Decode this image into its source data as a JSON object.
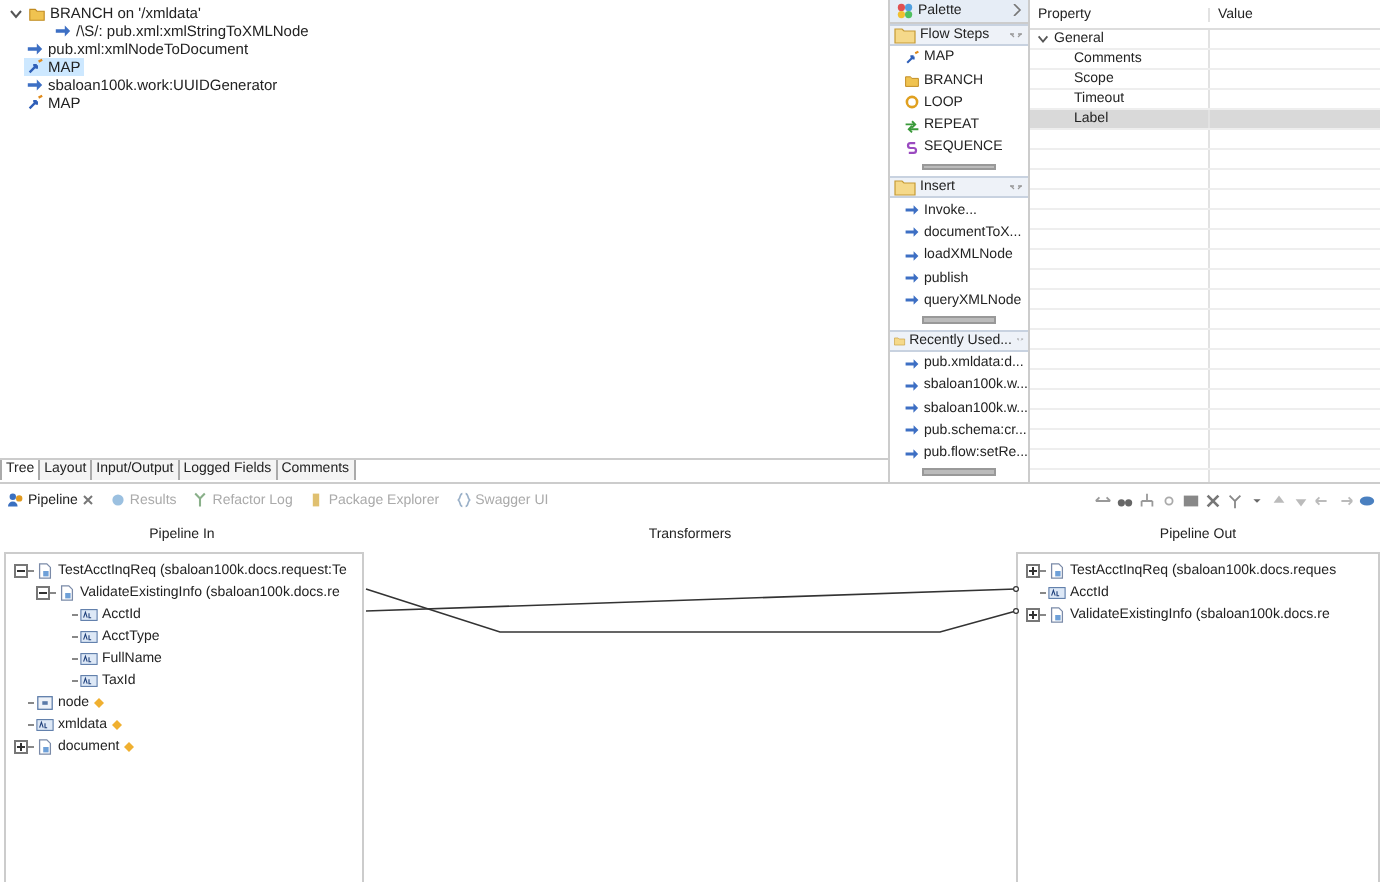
{
  "flow_tree": {
    "items": [
      {
        "kind": "branch",
        "label": "BRANCH on '/xmldata'",
        "expanded": true,
        "selected": false,
        "children": [
          {
            "kind": "invoke",
            "label": "/\\S/: pub.xml:xmlStringToXMLNode",
            "selected": false
          }
        ]
      },
      {
        "kind": "invoke",
        "label": "pub.xml:xmlNodeToDocument",
        "selected": false
      },
      {
        "kind": "map",
        "label": "MAP",
        "selected": true
      },
      {
        "kind": "invoke",
        "label": "sbaloan100k.work:UUIDGenerator",
        "selected": false
      },
      {
        "kind": "map",
        "label": "MAP",
        "selected": false
      }
    ]
  },
  "editor_tabs": [
    {
      "label": "Tree",
      "selected": true
    },
    {
      "label": "Layout",
      "selected": false
    },
    {
      "label": "Input/Output",
      "selected": false
    },
    {
      "label": "Logged Fields",
      "selected": false
    },
    {
      "label": "Comments",
      "selected": false
    }
  ],
  "palette": {
    "title": "Palette",
    "sections": [
      {
        "title": "Flow Steps",
        "items": [
          {
            "kind": "map",
            "label": "MAP"
          },
          {
            "kind": "branch",
            "label": "BRANCH"
          },
          {
            "kind": "loop",
            "label": "LOOP"
          },
          {
            "kind": "repeat",
            "label": "REPEAT"
          },
          {
            "kind": "sequence",
            "label": "SEQUENCE"
          }
        ]
      },
      {
        "title": "Insert",
        "items": [
          {
            "kind": "invoke",
            "label": "Invoke..."
          },
          {
            "kind": "invoke",
            "label": "documentToX..."
          },
          {
            "kind": "invoke",
            "label": "loadXMLNode"
          },
          {
            "kind": "invoke",
            "label": "publish"
          },
          {
            "kind": "invoke",
            "label": "queryXMLNode"
          }
        ]
      },
      {
        "title": "Recently Used...",
        "items": [
          {
            "kind": "invoke",
            "label": "pub.xmldata:d..."
          },
          {
            "kind": "invoke",
            "label": "sbaloan100k.w..."
          },
          {
            "kind": "invoke",
            "label": "sbaloan100k.w..."
          },
          {
            "kind": "invoke",
            "label": "pub.schema:cr..."
          },
          {
            "kind": "invoke",
            "label": "pub.flow:setRe..."
          }
        ]
      }
    ]
  },
  "properties": {
    "columns": [
      "Property",
      "Value"
    ],
    "groups": [
      {
        "label": "General",
        "expanded": true,
        "rows": [
          {
            "label": "Comments",
            "selected": false
          },
          {
            "label": "Scope",
            "selected": false
          },
          {
            "label": "Timeout",
            "selected": false
          },
          {
            "label": "Label",
            "selected": true
          }
        ]
      }
    ]
  },
  "view_tabs": [
    {
      "label": "Pipeline",
      "selected": true
    },
    {
      "label": "Results",
      "selected": false
    },
    {
      "label": "Refactor Log",
      "selected": false
    },
    {
      "label": "Package Explorer",
      "selected": false
    },
    {
      "label": "Swagger UI",
      "selected": false
    }
  ],
  "pipeline": {
    "columns": [
      "Pipeline In",
      "Transformers",
      "Pipeline Out"
    ],
    "in": [
      {
        "kind": "document",
        "label": "TestAcctInqReq (sbaloan100k.docs.request:Te",
        "expanded": true,
        "marked": false,
        "children": [
          {
            "kind": "document",
            "label": "ValidateExistingInfo (sbaloan100k.docs.re",
            "expanded": true,
            "marked": false,
            "children": [
              {
                "kind": "string",
                "label": "AcctId",
                "marked": false
              },
              {
                "kind": "string",
                "label": "AcctType",
                "marked": false
              },
              {
                "kind": "string",
                "label": "FullName",
                "marked": false
              },
              {
                "kind": "string",
                "label": "TaxId",
                "marked": false
              }
            ]
          }
        ]
      },
      {
        "kind": "node",
        "label": "node",
        "marked": true
      },
      {
        "kind": "string",
        "label": "xmldata",
        "marked": true
      },
      {
        "kind": "document",
        "label": "document",
        "expanded": false,
        "marked": true
      }
    ],
    "out": [
      {
        "kind": "document",
        "label": "TestAcctInqReq (sbaloan100k.docs.reques",
        "expanded": false,
        "marked": false
      },
      {
        "kind": "string",
        "label": "AcctId",
        "marked": false
      },
      {
        "kind": "document",
        "label": "ValidateExistingInfo (sbaloan100k.docs.re",
        "expanded": false,
        "marked": false
      }
    ]
  }
}
